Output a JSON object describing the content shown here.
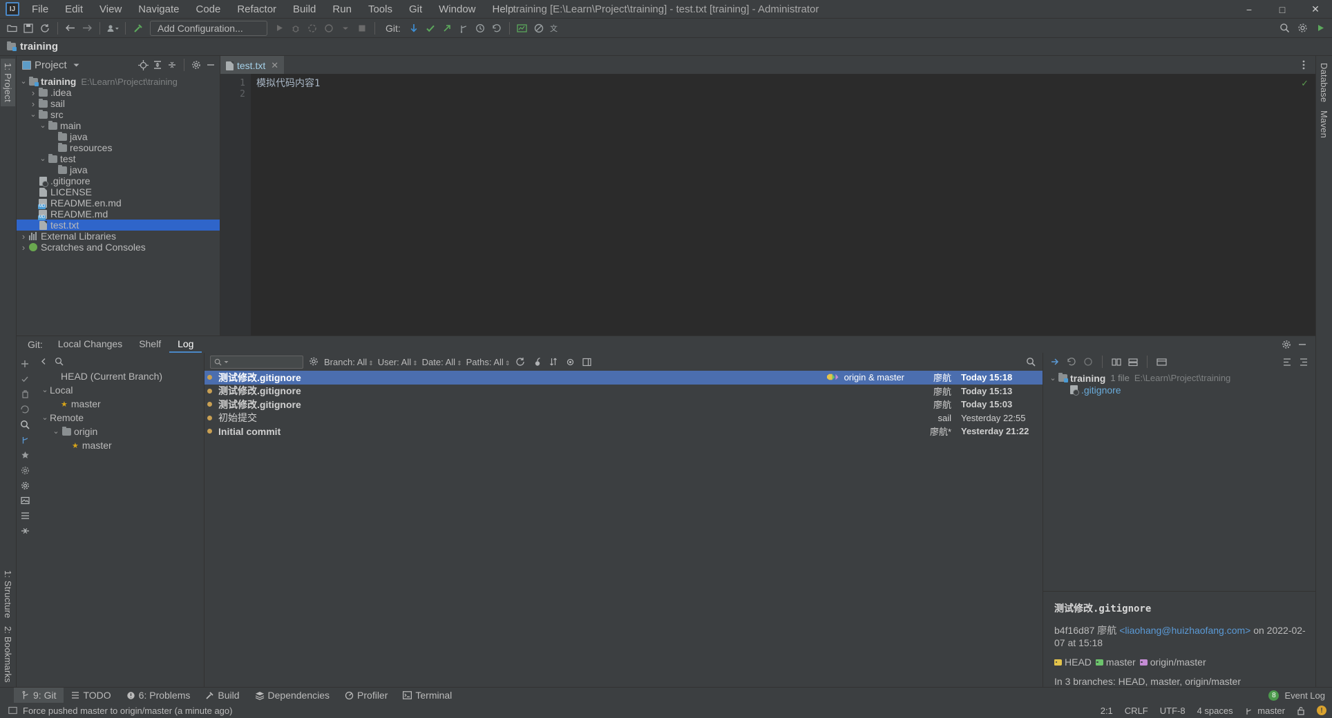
{
  "window": {
    "title": "training [E:\\Learn\\Project\\training] - test.txt [training] - Administrator",
    "logo": "IJ",
    "minimize": "−",
    "maximize": "□",
    "close": "✕"
  },
  "menubar": [
    {
      "label": "File"
    },
    {
      "label": "Edit"
    },
    {
      "label": "View"
    },
    {
      "label": "Navigate"
    },
    {
      "label": "Code"
    },
    {
      "label": "Refactor"
    },
    {
      "label": "Build"
    },
    {
      "label": "Run"
    },
    {
      "label": "Tools"
    },
    {
      "label": "Git"
    },
    {
      "label": "Window"
    },
    {
      "label": "Help"
    }
  ],
  "toolbar": {
    "run_config": "Add Configuration...",
    "git_label": "Git:",
    "icons": [
      "open-folder-icon",
      "save-icon",
      "sync-icon",
      "back-arrow-icon",
      "forward-arrow-icon",
      "profile-icon",
      "build-hammer-icon"
    ]
  },
  "navbar": {
    "crumb": "training"
  },
  "project_panel": {
    "title": "Project",
    "tree": [
      {
        "label": "training",
        "sub": "E:\\Learn\\Project\\training",
        "indent": 0,
        "arrow": "v",
        "icon": "module-icon",
        "bold": true
      },
      {
        "label": ".idea",
        "sub": "",
        "indent": 1,
        "arrow": ">",
        "icon": "folder-icon",
        "bold": false
      },
      {
        "label": "sail",
        "sub": "",
        "indent": 1,
        "arrow": ">",
        "icon": "folder-icon",
        "bold": false
      },
      {
        "label": "src",
        "sub": "",
        "indent": 1,
        "arrow": "v",
        "icon": "folder-icon",
        "bold": false
      },
      {
        "label": "main",
        "sub": "",
        "indent": 2,
        "arrow": "v",
        "icon": "folder-icon",
        "bold": false
      },
      {
        "label": "java",
        "sub": "",
        "indent": 3,
        "arrow": "",
        "icon": "folder-icon",
        "bold": false
      },
      {
        "label": "resources",
        "sub": "",
        "indent": 3,
        "arrow": "",
        "icon": "folder-icon",
        "bold": false
      },
      {
        "label": "test",
        "sub": "",
        "indent": 2,
        "arrow": "v",
        "icon": "folder-icon",
        "bold": false
      },
      {
        "label": "java",
        "sub": "",
        "indent": 3,
        "arrow": "",
        "icon": "folder-icon",
        "bold": false
      },
      {
        "label": ".gitignore",
        "sub": "",
        "indent": 1,
        "arrow": "",
        "icon": "gitignore-file-icon",
        "bold": false
      },
      {
        "label": "LICENSE",
        "sub": "",
        "indent": 1,
        "arrow": "",
        "icon": "text-file-icon",
        "bold": false
      },
      {
        "label": "README.en.md",
        "sub": "",
        "indent": 1,
        "arrow": "",
        "icon": "markdown-file-icon",
        "bold": false
      },
      {
        "label": "README.md",
        "sub": "",
        "indent": 1,
        "arrow": "",
        "icon": "markdown-file-icon",
        "bold": false
      },
      {
        "label": "test.txt",
        "sub": "",
        "indent": 1,
        "arrow": "",
        "icon": "text-file-icon",
        "bold": false,
        "selected": true
      },
      {
        "label": "External Libraries",
        "sub": "",
        "indent": 0,
        "arrow": ">",
        "icon": "library-icon",
        "bold": false
      },
      {
        "label": "Scratches and Consoles",
        "sub": "",
        "indent": 0,
        "arrow": ">",
        "icon": "scratches-icon",
        "bold": false
      }
    ]
  },
  "left_rail": {
    "tab": "1: Project"
  },
  "right_rail": {
    "tabs": [
      "Database",
      "Maven"
    ]
  },
  "bottom_rail": {
    "tabs": [
      "1: Structure",
      "2: Bookmarks"
    ]
  },
  "editor": {
    "tab_label": "test.txt",
    "tab_close": "✕",
    "lines": [
      "模拟代码内容1",
      ""
    ],
    "line_numbers": [
      "1",
      "2"
    ],
    "inspection_ok": "✓"
  },
  "git_window": {
    "label": "Git:",
    "tabs": [
      {
        "label": "Local Changes",
        "active": false
      },
      {
        "label": "Shelf",
        "active": false
      },
      {
        "label": "Log",
        "active": true
      }
    ]
  },
  "branch_panel": {
    "search_placeholder": "",
    "rows": [
      {
        "label": "HEAD (Current Branch)",
        "indent": 1,
        "arrow": "",
        "type": "head"
      },
      {
        "label": "Local",
        "indent": 0,
        "arrow": "v",
        "type": "group"
      },
      {
        "label": "master",
        "indent": 1,
        "arrow": "",
        "type": "branch-current"
      },
      {
        "label": "Remote",
        "indent": 0,
        "arrow": "v",
        "type": "group"
      },
      {
        "label": "origin",
        "indent": 1,
        "arrow": "v",
        "type": "remote-folder"
      },
      {
        "label": "master",
        "indent": 2,
        "arrow": "",
        "type": "branch"
      }
    ]
  },
  "log_toolbar": {
    "search_placeholder": "",
    "filters": [
      {
        "label": "Branch: All"
      },
      {
        "label": "User: All"
      },
      {
        "label": "Date: All"
      },
      {
        "label": "Paths: All"
      }
    ]
  },
  "commits": [
    {
      "subject": "测试修改.gitignore",
      "refs": "origin & master",
      "author": "廖航",
      "date": "Today 15:18",
      "selected": true,
      "bold": true
    },
    {
      "subject": "测试修改.gitignore",
      "refs": "",
      "author": "廖航",
      "date": "Today 15:13",
      "selected": false,
      "bold": true
    },
    {
      "subject": "测试修改.gitignore",
      "refs": "",
      "author": "廖航",
      "date": "Today 15:03",
      "selected": false,
      "bold": true
    },
    {
      "subject": "初始提交",
      "refs": "",
      "author": "sail",
      "date": "Yesterday 22:55",
      "selected": false,
      "bold": false
    },
    {
      "subject": "Initial commit",
      "refs": "",
      "author": "廖航*",
      "date": "Yesterday 21:22",
      "selected": false,
      "bold": true
    }
  ],
  "detail_panel": {
    "tree": [
      {
        "label": "training",
        "count": "1 file",
        "path": "E:\\Learn\\Project\\training",
        "indent": 0,
        "arrow": "v",
        "icon": "module-icon"
      },
      {
        "label": ".gitignore",
        "count": "",
        "path": "",
        "indent": 1,
        "arrow": "",
        "icon": "gitignore-file-icon"
      }
    ],
    "subject": "测试修改.gitignore",
    "hash": "b4f16d87",
    "author": "廖航",
    "email": "<liaohang@huizhaofang.com>",
    "date_text": "on 2022-02-07 at 15:18",
    "refs": [
      {
        "label": "HEAD",
        "color": "#e3c34b"
      },
      {
        "label": "master",
        "color": "#6cc36c"
      },
      {
        "label": "origin/master",
        "color": "#c48cd4"
      }
    ],
    "branches_text": "In 3 branches: HEAD, master, origin/master"
  },
  "bottom_tabs": [
    {
      "label": "9: Git",
      "icon": "git-branch-icon",
      "active": true
    },
    {
      "label": "TODO",
      "icon": "list-icon",
      "active": false
    },
    {
      "label": "6: Problems",
      "icon": "error-circle-icon",
      "active": false
    },
    {
      "label": "Build",
      "icon": "hammer-icon",
      "active": false
    },
    {
      "label": "Dependencies",
      "icon": "layers-icon",
      "active": false
    },
    {
      "label": "Profiler",
      "icon": "profiler-icon",
      "active": false
    },
    {
      "label": "Terminal",
      "icon": "terminal-icon",
      "active": false
    }
  ],
  "event_log": {
    "label": "Event Log",
    "count": "8"
  },
  "statusbar": {
    "message": "Force pushed master to origin/master (a minute ago)",
    "caret": "2:1",
    "line_sep": "CRLF",
    "encoding": "UTF-8",
    "indent": "4 spaces",
    "branch": "master",
    "lock_icon": "lock-icon",
    "notify_icon": "notification-icon"
  },
  "colors": {
    "accent": "#4b6eaf",
    "selection": "#2f65ca",
    "bg": "#3c3f41",
    "editor_bg": "#2b2b2b",
    "link": "#5b9ad6"
  }
}
